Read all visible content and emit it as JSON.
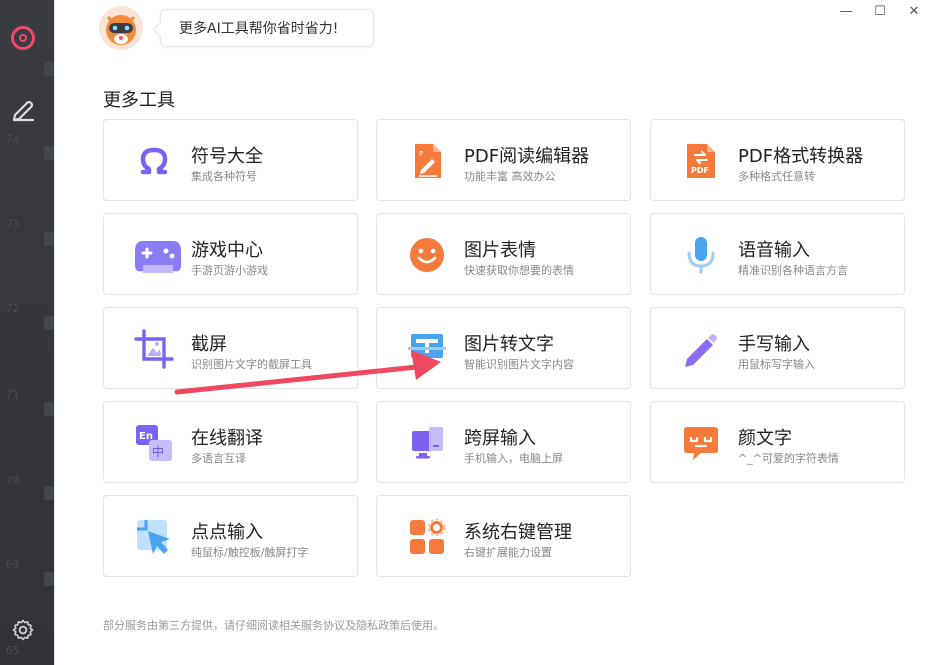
{
  "header": {
    "bubble_text": "更多AI工具帮你省时省力!"
  },
  "window": {
    "minimize": "—",
    "maximize": "☐",
    "close": "✕"
  },
  "section": {
    "title": "更多工具"
  },
  "tools": [
    {
      "name": "符号大全",
      "desc": "集成各种符号",
      "icon": "omega-icon",
      "color": "#7b62f2"
    },
    {
      "name": "PDF阅读编辑器",
      "desc": "功能丰富 高效办公",
      "icon": "pdf-edit-icon",
      "color": "#f57a3c"
    },
    {
      "name": "PDF格式转换器",
      "desc": "多种格式任意转",
      "icon": "pdf-convert-icon",
      "color": "#f57a3c"
    },
    {
      "name": "游戏中心",
      "desc": "手游页游小游戏",
      "icon": "gamepad-icon",
      "color": "#8a7cf5"
    },
    {
      "name": "图片表情",
      "desc": "快速获取你想要的表情",
      "icon": "smiley-icon",
      "color": "#f57a3c"
    },
    {
      "name": "语音输入",
      "desc": "精准识别各种语言方言",
      "icon": "microphone-icon",
      "color": "#4aa3ef"
    },
    {
      "name": "截屏",
      "desc": "识别图片文字的截屏工具",
      "icon": "screenshot-icon",
      "color": "#7b62f2"
    },
    {
      "name": "图片转文字",
      "desc": "智能识别图片文字内容",
      "icon": "image-to-text-icon",
      "color": "#4aa3ef"
    },
    {
      "name": "手写输入",
      "desc": "用鼠标写字输入",
      "icon": "pen-icon",
      "color": "#8a6cf0"
    },
    {
      "name": "在线翻译",
      "desc": "多语言互译",
      "icon": "translate-icon",
      "color": "#7b62f2"
    },
    {
      "name": "跨屏输入",
      "desc": "手机输入，电脑上屏",
      "icon": "cross-screen-icon",
      "color": "#7b62f2"
    },
    {
      "name": "颜文字",
      "desc": "^_^可爱的字符表情",
      "icon": "kaomoji-icon",
      "color": "#f57a3c"
    },
    {
      "name": "点点输入",
      "desc": "纯鼠标/触控板/触屏打字",
      "icon": "click-input-icon",
      "color": "#4aa3ef"
    },
    {
      "name": "系统右键管理",
      "desc": "右键扩展能力设置",
      "icon": "context-menu-icon",
      "color": "#f57a3c"
    }
  ],
  "footer": {
    "note": "部分服务由第三方提供，请仔细阅读相关服务协议及隐私政策后使用。"
  },
  "sidebar": {
    "ghost_numbers": [
      "74",
      "73",
      "72",
      "71",
      "70",
      "69",
      "65"
    ]
  },
  "colors": {
    "sidebar_bg": "#333539",
    "accent_pink": "#ef4a6a",
    "arrow_red": "#f0495f"
  }
}
